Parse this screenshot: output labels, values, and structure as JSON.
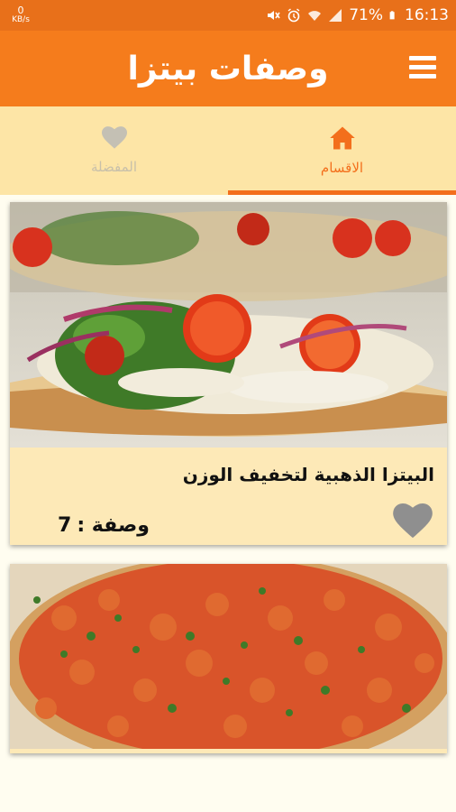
{
  "status_bar": {
    "speed_value": "0",
    "speed_unit": "KB/s",
    "battery": "71%",
    "time": "16:13",
    "icons": [
      "mute-icon",
      "alarm-icon",
      "wifi-icon",
      "signal-icon",
      "battery-icon"
    ]
  },
  "app_bar": {
    "title": "وصفات بيتزا",
    "menu_icon": "hamburger-menu-icon"
  },
  "tabs": [
    {
      "label": "المفضلة",
      "icon": "heart-icon",
      "active": false
    },
    {
      "label": "الاقسام",
      "icon": "home-icon",
      "active": true
    }
  ],
  "colors": {
    "primary": "#f57c1c",
    "status_bar": "#e8701a",
    "tab_bar": "#fde5a6",
    "active_tab": "#f36f1c",
    "card_bg": "#fde9b7"
  },
  "cards": [
    {
      "title": "البيتزا الذهبية لتخفيف الوزن",
      "count_label": "وصفة :",
      "count_value": "7",
      "favorite_icon": "heart-icon"
    }
  ]
}
